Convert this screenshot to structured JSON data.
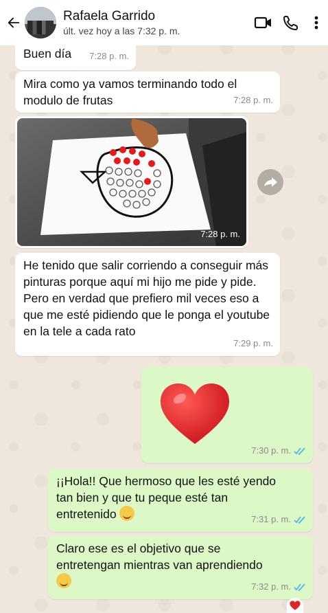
{
  "header": {
    "contact_name": "Rafaela Garrido",
    "last_seen": "últ. vez hoy a las 7:32 p. m."
  },
  "messages": [
    {
      "id": "m1",
      "text": "Buen día",
      "time": "7:28 p. m."
    },
    {
      "id": "m2",
      "text": "Mira como ya vamos terminando todo el modulo de frutas",
      "time": "7:28 p. m."
    },
    {
      "id": "m3",
      "type": "image",
      "time": "7:28 p. m."
    },
    {
      "id": "m4",
      "text": "He tenido que salir corriendo a conseguir más pinturas porque aquí mi hijo me pide y pide. Pero en verdad que prefiero mil veces eso a que me esté pidiendo que le ponga el youtube en la tele a cada rato",
      "time": "7:29 p. m."
    },
    {
      "id": "m5",
      "type": "emoji",
      "emoji": "heart",
      "time": "7:30 p. m."
    },
    {
      "id": "m6",
      "text": "¡¡Hola!! Que hermoso que les esté yendo tan bien y que tu peque esté tan entretenido",
      "time": "7:31 p. m."
    },
    {
      "id": "m7",
      "text": "Claro ese es el objetivo que se entretengan mientras van aprendiendo",
      "time": "7:32 p. m."
    }
  ],
  "icons": {
    "back": "arrow-left-icon",
    "video": "video-call-icon",
    "phone": "phone-icon",
    "menu": "more-vert-icon",
    "forward": "forward-icon",
    "read": "double-check-icon"
  },
  "colors": {
    "chat_bg": "#efe7dd",
    "incoming": "#ffffff",
    "outgoing": "#dcf8c6",
    "read_tick": "#4fb6ec",
    "heart": "#e0242a"
  }
}
